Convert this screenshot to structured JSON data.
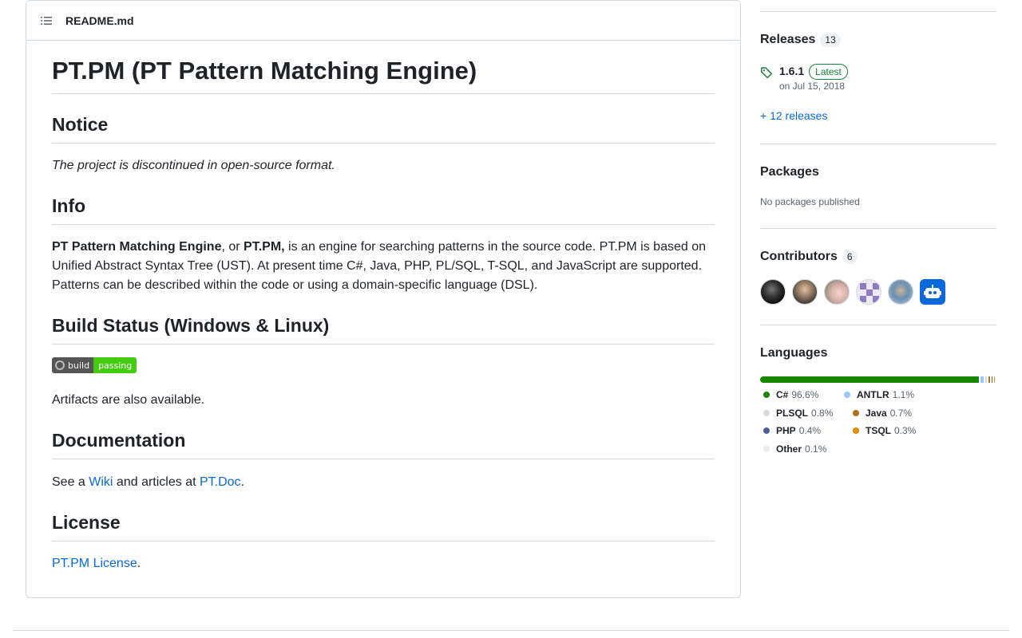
{
  "readme": {
    "filename": "README.md",
    "title": "PT.PM (PT Pattern Matching Engine)",
    "notice": {
      "heading": "Notice",
      "text": "The project is discontinued in open-source format."
    },
    "info": {
      "heading": "Info",
      "bold1": "PT Pattern Matching Engine",
      "sep1": ", or ",
      "bold2": "PT.PM,",
      "rest": " is an engine for searching patterns in the source code. PT.PM is based on Unified Abstract Syntax Tree (UST). At present time C#, Java, PHP, PL/SQL, T-SQL, and JavaScript are supported. Patterns can be described within the code or using a domain-specific language (DSL)."
    },
    "build": {
      "heading": "Build Status (Windows & Linux)",
      "badge_left": "build",
      "badge_right": "passing",
      "artifacts": "Artifacts are also available."
    },
    "documentation": {
      "heading": "Documentation",
      "prefix": "See a ",
      "wiki_link": "Wiki",
      "middle": " and articles at ",
      "doc_link": "PT.Doc",
      "suffix": "."
    },
    "license": {
      "heading": "License",
      "link": "PT.PM License",
      "suffix": "."
    }
  },
  "sidebar": {
    "releases": {
      "heading": "Releases",
      "count": "13",
      "version": "1.6.1",
      "latest_label": "Latest",
      "date": "on Jul 15, 2018",
      "more": "+ 12 releases"
    },
    "packages": {
      "heading": "Packages",
      "text": "No packages published"
    },
    "contributors": {
      "heading": "Contributors",
      "count": "6"
    },
    "languages": {
      "heading": "Languages",
      "items": [
        {
          "name": "C#",
          "pct": "96.6%",
          "value": 96.6,
          "color": "#178600"
        },
        {
          "name": "ANTLR",
          "pct": "1.1%",
          "value": 1.1,
          "color": "#9dc3ff"
        },
        {
          "name": "PLSQL",
          "pct": "0.8%",
          "value": 0.8,
          "color": "#dad8d8"
        },
        {
          "name": "Java",
          "pct": "0.7%",
          "value": 0.7,
          "color": "#b07219"
        },
        {
          "name": "PHP",
          "pct": "0.4%",
          "value": 0.4,
          "color": "#4F5D95"
        },
        {
          "name": "TSQL",
          "pct": "0.3%",
          "value": 0.3,
          "color": "#e38c00"
        },
        {
          "name": "Other",
          "pct": "0.1%",
          "value": 0.1,
          "color": "#ededed"
        }
      ]
    }
  }
}
